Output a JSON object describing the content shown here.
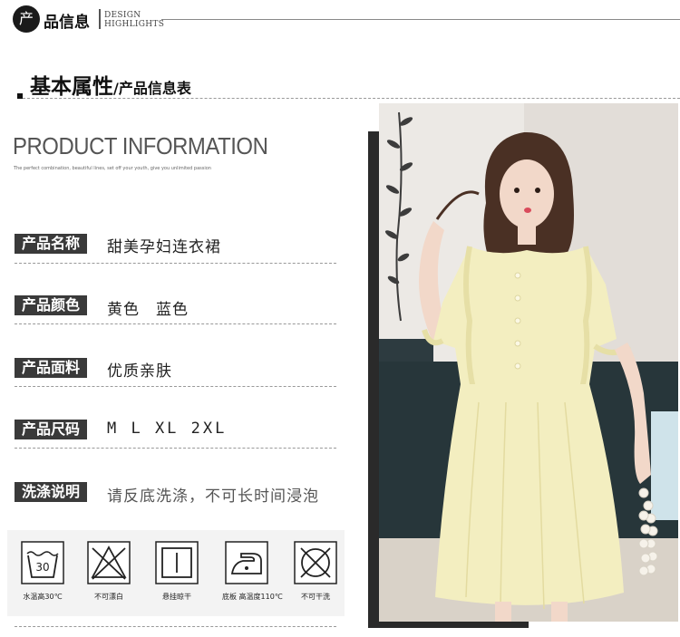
{
  "header": {
    "badge_char": "产",
    "title": "品信息",
    "en_line1": "DESIGN",
    "en_line2": "HIGHLIGHTS"
  },
  "section": {
    "title": "基本属性",
    "subtitle": "/产品信息表"
  },
  "product_info": {
    "heading": "PRODUCT INFORMATION",
    "tagline": "The perfect combination, beautiful lines, set off your youth, give you unlimited passion"
  },
  "rows": [
    {
      "label": "产品名称",
      "value": "甜美孕妇连衣裙"
    },
    {
      "label": "产品颜色",
      "value": "黄色　蓝色"
    },
    {
      "label": "产品面料",
      "value": "优质亲肤"
    },
    {
      "label": "产品尺码",
      "value": "M  L  XL  2XL"
    },
    {
      "label": "洗涤说明",
      "value": "请反底洗涤，不可长时间浸泡"
    }
  ],
  "care": [
    {
      "icon": "wash-30-icon",
      "caption": "水温高30℃",
      "text": "30"
    },
    {
      "icon": "no-bleach-icon",
      "caption": "不可漂白"
    },
    {
      "icon": "hang-dry-icon",
      "caption": "悬挂晾干"
    },
    {
      "icon": "iron-110-icon",
      "caption": "底板 高温度110℃"
    },
    {
      "icon": "no-dry-clean-icon",
      "caption": "不可干洗"
    }
  ],
  "colors": {
    "dress": "#f3eec0",
    "label_bg": "#3a3a3a"
  }
}
